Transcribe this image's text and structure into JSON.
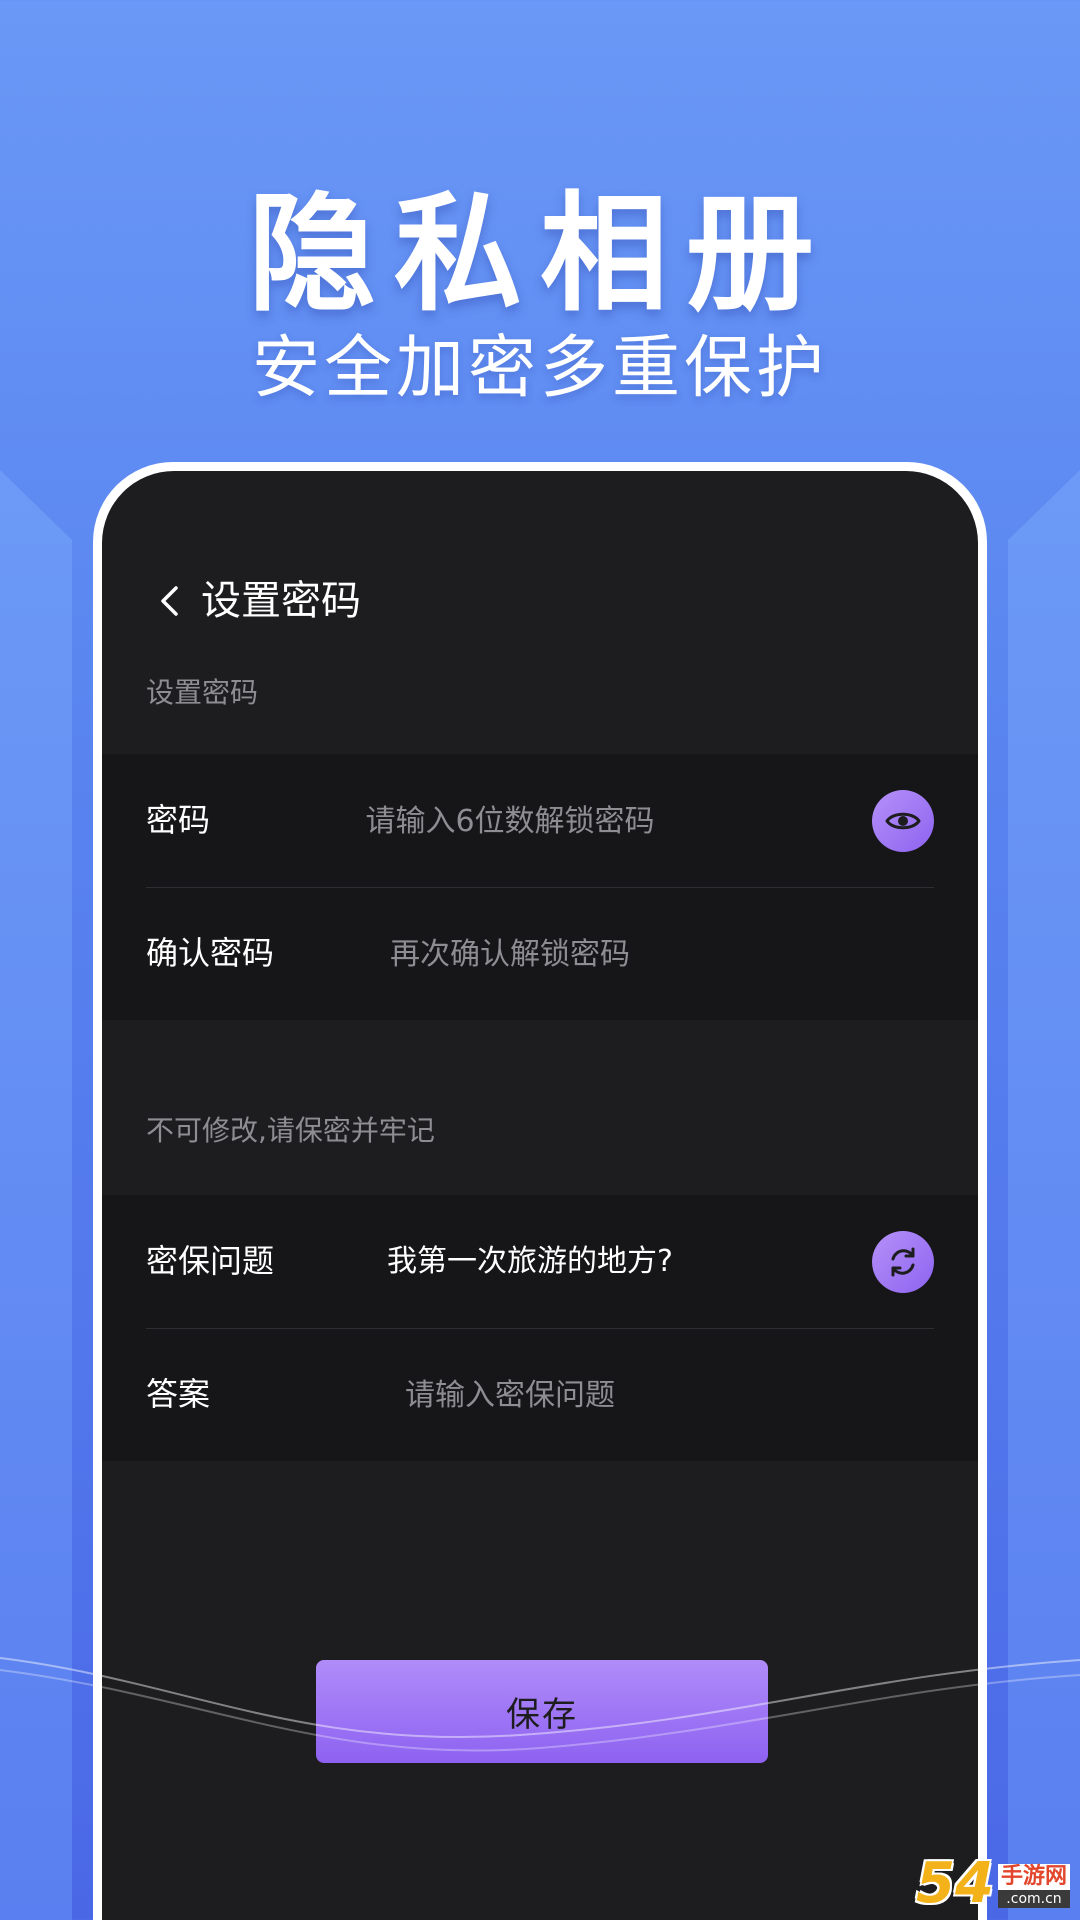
{
  "hero": {
    "title": "隐私相册",
    "subtitle": "安全加密多重保护"
  },
  "nav": {
    "back_icon": "chevron-left-icon",
    "title": "设置密码"
  },
  "password_section": {
    "label": "设置密码",
    "password": {
      "label": "密码",
      "placeholder": "请输入6位数解锁密码",
      "toggle_icon": "eye-icon"
    },
    "confirm": {
      "label": "确认密码",
      "placeholder": "再次确认解锁密码"
    }
  },
  "security_section": {
    "label": "不可修改,请保密并牢记",
    "question": {
      "label": "密保问题",
      "value": "我第一次旅游的地方?",
      "refresh_icon": "refresh-icon"
    },
    "answer": {
      "label": "答案",
      "placeholder": "请输入密保问题"
    }
  },
  "save_button": {
    "label": "保存"
  },
  "watermark": {
    "number": "54",
    "brand": "手游网",
    "url": ".com.cn"
  },
  "colors": {
    "background": "#5a86f0",
    "screen": "#1d1d1f",
    "accent": "#9a72f4",
    "muted_text": "#8d8d92"
  }
}
